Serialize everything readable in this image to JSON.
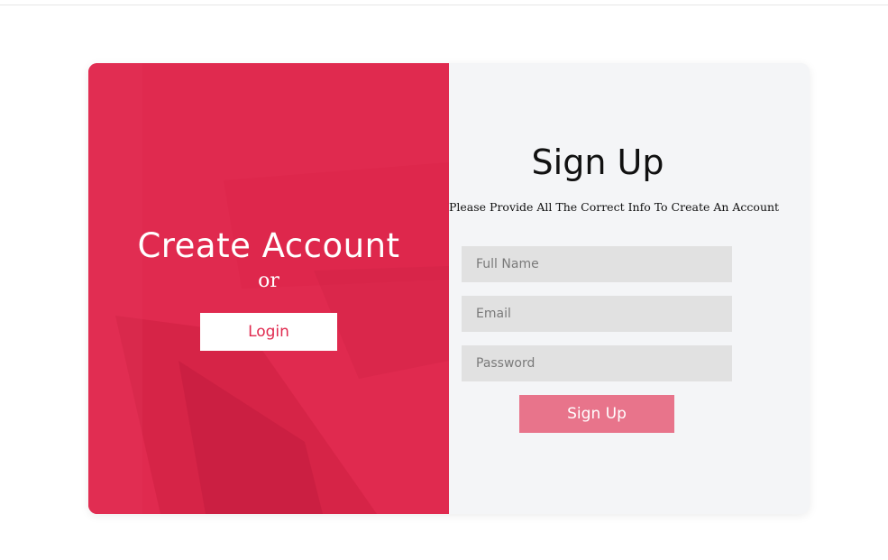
{
  "colors": {
    "accent": "#e02a4f",
    "accent_light": "#e8748b",
    "panel_bg": "#f4f5f7",
    "field_bg": "#e1e1e1"
  },
  "left_panel": {
    "title": "Create Account",
    "or_text": "or",
    "login_label": "Login"
  },
  "right_panel": {
    "title": "Sign Up",
    "subtitle": "Please Provide All The Correct Info To Create An Account",
    "fields": {
      "full_name": {
        "value": "",
        "placeholder": "Full Name"
      },
      "email": {
        "value": "",
        "placeholder": "Email"
      },
      "password": {
        "value": "",
        "placeholder": "Password"
      }
    },
    "submit_label": "Sign Up"
  }
}
